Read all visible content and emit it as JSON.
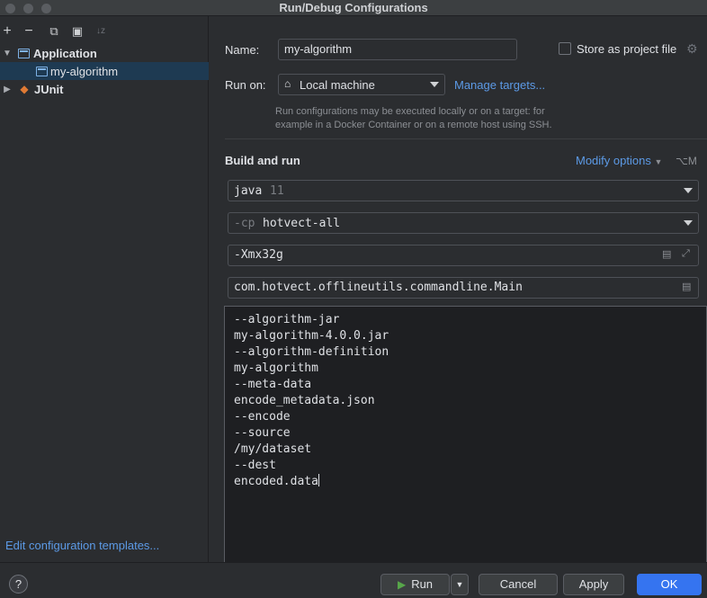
{
  "window": {
    "title": "Run/Debug Configurations"
  },
  "toolbar": {
    "add": "+",
    "remove": "−",
    "copy": "⧉",
    "folder": "▣",
    "sort": "↓z"
  },
  "tree": {
    "application_label": "Application",
    "my_algorithm_label": "my-algorithm",
    "junit_label": "JUnit"
  },
  "left": {
    "edit_templates": "Edit configuration templates..."
  },
  "form": {
    "name_label": "Name:",
    "name_value": "my-algorithm",
    "store_label": "Store as project file",
    "run_on_label": "Run on:",
    "run_on_value": "Local machine",
    "manage_targets": "Manage targets...",
    "hint": "Run configurations may be executed locally or on a target: for example in a Docker Container or on a remote host using SSH.",
    "build_run": "Build and run",
    "modify_options": "Modify options",
    "modify_shortcut": "⌥M",
    "jdk_main": "java",
    "jdk_version": "11",
    "cp_prefix": "-cp",
    "cp_value": "hotvect-all",
    "vm_options": "-Xmx32g",
    "main_class": "com.hotvect.offlineutils.commandline.Main",
    "program_args": [
      "--algorithm-jar",
      "my-algorithm-4.0.0.jar",
      "--algorithm-definition",
      "my-algorithm",
      "--meta-data",
      "encode_metadata.json",
      "--encode",
      "--source",
      "/my/dataset",
      "--dest",
      "encoded.data"
    ]
  },
  "buttons": {
    "help": "?",
    "run": "Run",
    "cancel": "Cancel",
    "apply": "Apply",
    "ok": "OK"
  }
}
